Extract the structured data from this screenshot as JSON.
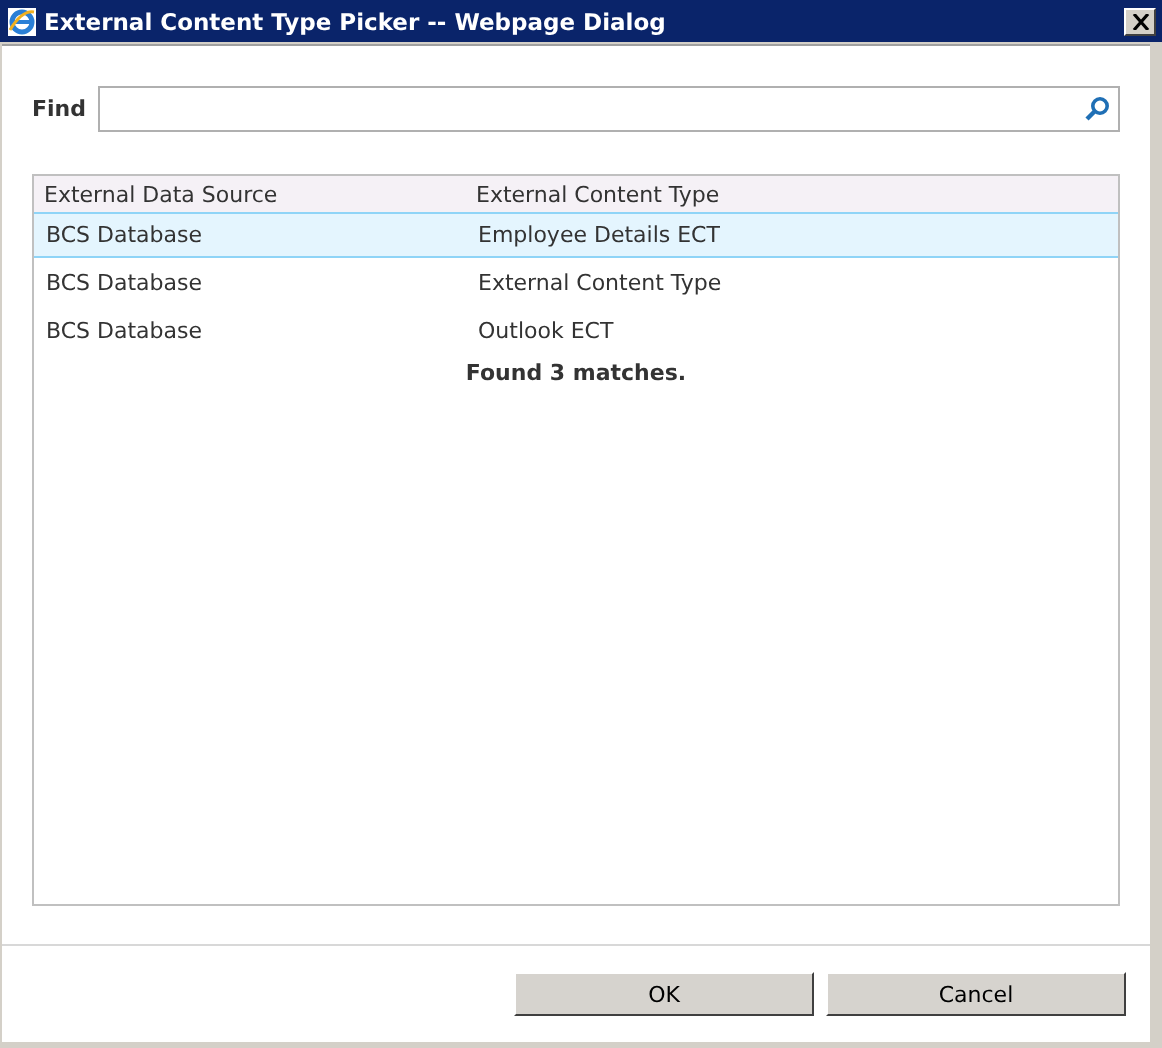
{
  "window": {
    "title": "External Content Type Picker -- Webpage Dialog"
  },
  "find": {
    "label": "Find"
  },
  "table": {
    "columns": [
      "External Data Source",
      "External Content Type"
    ],
    "rows": [
      {
        "cells": [
          "BCS Database",
          "Employee Details ECT"
        ],
        "selected": true
      },
      {
        "cells": [
          "BCS Database",
          "External Content Type"
        ],
        "selected": false
      },
      {
        "cells": [
          "BCS Database",
          "Outlook ECT"
        ],
        "selected": false
      }
    ],
    "status": "Found 3 matches."
  },
  "buttons": [
    "OK",
    "Cancel"
  ]
}
